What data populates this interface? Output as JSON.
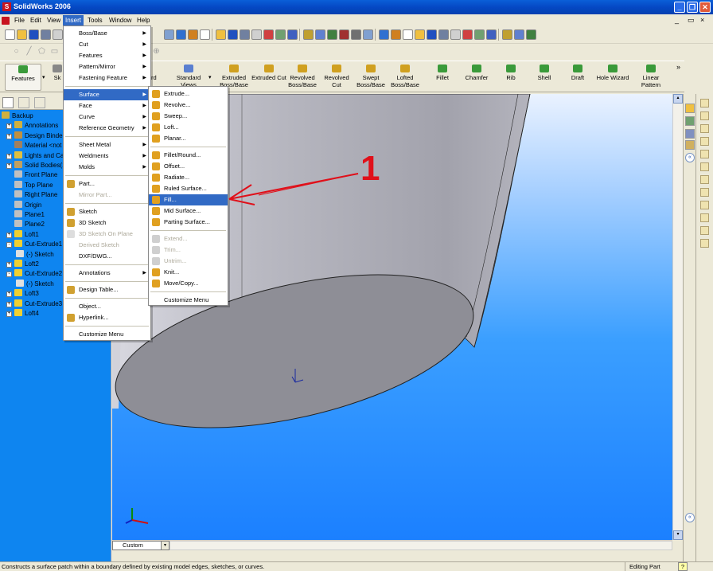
{
  "window": {
    "title": "SolidWorks 2006",
    "logo_text": "S"
  },
  "menubar": [
    "File",
    "Edit",
    "View",
    "Insert",
    "Tools",
    "Window",
    "Help"
  ],
  "command_manager": {
    "features_tab": "Features",
    "sketch_tab": "Sk",
    "hidden_std_views": "rd",
    "standard_views": "Standard Views",
    "buttons": [
      "Extruded Boss/Base",
      "Extruded Cut",
      "Revolved Boss/Base",
      "Revolved Cut",
      "Swept Boss/Base",
      "Lofted Boss/Base",
      "Fillet",
      "Chamfer",
      "Rib",
      "Shell",
      "Draft",
      "Hole Wizard",
      "Linear Pattern"
    ]
  },
  "tree": {
    "items": [
      {
        "label": "Backup",
        "level": 0,
        "expand": ""
      },
      {
        "label": "Annotations",
        "level": 1,
        "expand": "+"
      },
      {
        "label": "Design Binder",
        "level": 1,
        "expand": "+"
      },
      {
        "label": "Material <not",
        "level": 1,
        "expand": ""
      },
      {
        "label": "Lights and Ca",
        "level": 1,
        "expand": "+"
      },
      {
        "label": "Solid Bodies(1",
        "level": 1,
        "expand": "+"
      },
      {
        "label": "Front Plane",
        "level": 1,
        "expand": ""
      },
      {
        "label": "Top Plane",
        "level": 1,
        "expand": ""
      },
      {
        "label": "Right Plane",
        "level": 1,
        "expand": ""
      },
      {
        "label": "Origin",
        "level": 1,
        "expand": ""
      },
      {
        "label": "Plane1",
        "level": 1,
        "expand": ""
      },
      {
        "label": "Plane2",
        "level": 1,
        "expand": ""
      },
      {
        "label": "Loft1",
        "level": 1,
        "expand": "+"
      },
      {
        "label": "Cut-Extrude1",
        "level": 1,
        "expand": "-"
      },
      {
        "label": "(-) Sketch",
        "level": 2,
        "expand": ""
      },
      {
        "label": "Loft2",
        "level": 1,
        "expand": "+"
      },
      {
        "label": "Cut-Extrude2",
        "level": 1,
        "expand": "-"
      },
      {
        "label": "(-) Sketch",
        "level": 2,
        "expand": ""
      },
      {
        "label": "Loft3",
        "level": 1,
        "expand": "+"
      },
      {
        "label": "Cut-Extrude3",
        "level": 1,
        "expand": "+"
      },
      {
        "label": "Loft4",
        "level": 1,
        "expand": "+"
      }
    ]
  },
  "insert_menu": {
    "items": [
      {
        "label": "Boss/Base",
        "sub": true,
        "state": ""
      },
      {
        "label": "Cut",
        "sub": true,
        "state": ""
      },
      {
        "label": "Features",
        "sub": true,
        "state": ""
      },
      {
        "label": "Pattern/Mirror",
        "sub": true,
        "state": ""
      },
      {
        "label": "Fastening Feature",
        "sub": true,
        "state": ""
      },
      {
        "sep": true
      },
      {
        "label": "Surface",
        "sub": true,
        "state": "hl"
      },
      {
        "label": "Face",
        "sub": true,
        "state": ""
      },
      {
        "label": "Curve",
        "sub": true,
        "state": ""
      },
      {
        "label": "Reference Geometry",
        "sub": true,
        "state": ""
      },
      {
        "sep": true
      },
      {
        "label": "Sheet Metal",
        "sub": true,
        "state": ""
      },
      {
        "label": "Weldments",
        "sub": true,
        "state": ""
      },
      {
        "label": "Molds",
        "sub": true,
        "state": ""
      },
      {
        "sep": true
      },
      {
        "label": "Part...",
        "sub": false,
        "state": "",
        "icon": true
      },
      {
        "label": "Mirror Part...",
        "sub": false,
        "state": "dis"
      },
      {
        "sep": true
      },
      {
        "label": "Sketch",
        "sub": false,
        "state": "",
        "icon": true
      },
      {
        "label": "3D Sketch",
        "sub": false,
        "state": "",
        "icon": true
      },
      {
        "label": "3D Sketch On Plane",
        "sub": false,
        "state": "dis",
        "icon": true
      },
      {
        "label": "Derived Sketch",
        "sub": false,
        "state": "dis"
      },
      {
        "label": "DXF/DWG...",
        "sub": false,
        "state": ""
      },
      {
        "sep": true
      },
      {
        "label": "Annotations",
        "sub": true,
        "state": ""
      },
      {
        "sep": true
      },
      {
        "label": "Design Table...",
        "sub": false,
        "state": "",
        "icon": true
      },
      {
        "sep": true
      },
      {
        "label": "Object...",
        "sub": false,
        "state": ""
      },
      {
        "label": "Hyperlink...",
        "sub": false,
        "state": "",
        "icon": true
      },
      {
        "sep": true
      },
      {
        "label": "Customize Menu",
        "sub": false,
        "state": ""
      }
    ]
  },
  "surface_menu": {
    "items": [
      {
        "label": "Extrude...",
        "state": ""
      },
      {
        "label": "Revolve...",
        "state": ""
      },
      {
        "label": "Sweep...",
        "state": ""
      },
      {
        "label": "Loft...",
        "state": ""
      },
      {
        "label": "Planar...",
        "state": ""
      },
      {
        "sep": true
      },
      {
        "label": "Fillet/Round...",
        "state": ""
      },
      {
        "label": "Offset...",
        "state": ""
      },
      {
        "label": "Radiate...",
        "state": ""
      },
      {
        "label": "Ruled Surface...",
        "state": ""
      },
      {
        "label": "Fill...",
        "state": "hl"
      },
      {
        "label": "Mid Surface...",
        "state": ""
      },
      {
        "label": "Parting Surface...",
        "state": ""
      },
      {
        "sep": true
      },
      {
        "label": "Extend...",
        "state": "dis"
      },
      {
        "label": "Trim...",
        "state": "dis"
      },
      {
        "label": "Untrim...",
        "state": "dis"
      },
      {
        "label": "Knit...",
        "state": ""
      },
      {
        "label": "Move/Copy...",
        "state": ""
      },
      {
        "sep": true
      },
      {
        "label": "Customize Menu",
        "state": ""
      }
    ]
  },
  "annotation": {
    "number": "1",
    "color": "#e0101a"
  },
  "view_dropdown": "Custom",
  "status": {
    "message": "Constructs a surface patch within a boundary defined by existing model edges, sketches, or curves.",
    "mode": "Editing Part",
    "help": "?"
  },
  "colors": {
    "accent": "#316ac5",
    "viewport_blue": "#1b80ff",
    "model_gray": "#8e8e96"
  }
}
